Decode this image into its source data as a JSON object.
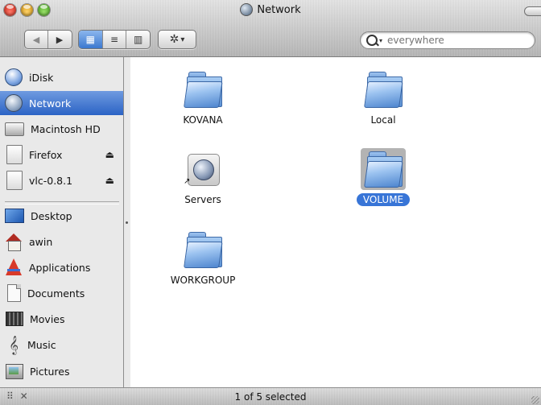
{
  "window": {
    "title": "Network"
  },
  "toolbar": {
    "back_symbol": "◀",
    "forward_symbol": "▶",
    "view_icon_symbol": "▦",
    "view_list_symbol": "≡",
    "view_column_symbol": "▥",
    "action_symbol": "✲",
    "action_caret": "▾",
    "search_caret": "▾",
    "search_value": "",
    "search_placeholder": "everywhere"
  },
  "sidebar": {
    "devices": [
      {
        "label": "iDisk",
        "icon": "idisk-icon"
      },
      {
        "label": "Network",
        "icon": "network-icon",
        "selected": true
      },
      {
        "label": "Macintosh HD",
        "icon": "hard-drive-icon"
      },
      {
        "label": "Firefox",
        "icon": "disk-image-icon",
        "eject": "⏏"
      },
      {
        "label": "vlc-0.8.1",
        "icon": "disk-image-icon",
        "eject": "⏏"
      }
    ],
    "places": [
      {
        "label": "Desktop",
        "icon": "desktop-icon"
      },
      {
        "label": "awin",
        "icon": "home-icon"
      },
      {
        "label": "Applications",
        "icon": "applications-icon"
      },
      {
        "label": "Documents",
        "icon": "documents-icon"
      },
      {
        "label": "Movies",
        "icon": "movies-icon"
      },
      {
        "label": "Music",
        "icon": "music-icon",
        "glyph": "𝄞"
      },
      {
        "label": "Pictures",
        "icon": "pictures-icon"
      }
    ]
  },
  "content": {
    "items": [
      {
        "label": "KOVANA",
        "type": "folder",
        "selected": false
      },
      {
        "label": "Local",
        "type": "folder",
        "selected": false
      },
      {
        "label": "Servers",
        "type": "alias-network",
        "selected": false
      },
      {
        "label": "VOLUME",
        "type": "folder",
        "selected": true
      },
      {
        "label": "WORKGROUP",
        "type": "folder",
        "selected": false
      }
    ]
  },
  "statusbar": {
    "text": "1 of 5 selected",
    "tools": "⠿ ✕"
  },
  "colors": {
    "selection": "#3875d7",
    "sidebar_bg": "#e9e9e9",
    "content_bg": "#ffffff"
  }
}
